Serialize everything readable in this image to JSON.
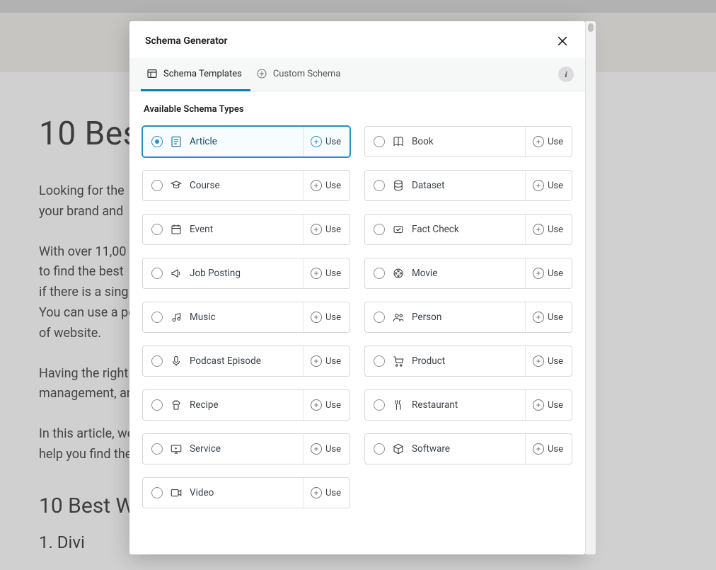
{
  "background": {
    "title": "10 Best",
    "p1": "Looking for the",
    "p1b": "your brand and",
    "p2": "With over 11,00",
    "p2b": "to find the best",
    "p2c": "if there is a sing",
    "p2d": "You can use a po",
    "p2e": "of website.",
    "p3": "Having the right",
    "p3b": "management, an",
    "p4": "In this article, we",
    "p4b": "help you find the",
    "h2": "10 Best W",
    "h3": "1. Divi"
  },
  "modal": {
    "title": "Schema Generator",
    "tab_templates": "Schema Templates",
    "tab_custom": "Custom Schema",
    "section_label": "Available Schema Types",
    "use_label": "Use",
    "types_left": [
      {
        "id": "article",
        "label": "Article",
        "icon": "article",
        "selected": true
      },
      {
        "id": "course",
        "label": "Course",
        "icon": "course"
      },
      {
        "id": "event",
        "label": "Event",
        "icon": "event"
      },
      {
        "id": "jobposting",
        "label": "Job Posting",
        "icon": "megaphone"
      },
      {
        "id": "music",
        "label": "Music",
        "icon": "music"
      },
      {
        "id": "podcast",
        "label": "Podcast Episode",
        "icon": "mic"
      },
      {
        "id": "recipe",
        "label": "Recipe",
        "icon": "recipe"
      },
      {
        "id": "service",
        "label": "Service",
        "icon": "service"
      },
      {
        "id": "video",
        "label": "Video",
        "icon": "video"
      }
    ],
    "types_right": [
      {
        "id": "book",
        "label": "Book",
        "icon": "book"
      },
      {
        "id": "dataset",
        "label": "Dataset",
        "icon": "dataset"
      },
      {
        "id": "factcheck",
        "label": "Fact Check",
        "icon": "factcheck"
      },
      {
        "id": "movie",
        "label": "Movie",
        "icon": "movie"
      },
      {
        "id": "person",
        "label": "Person",
        "icon": "person"
      },
      {
        "id": "product",
        "label": "Product",
        "icon": "product"
      },
      {
        "id": "restaurant",
        "label": "Restaurant",
        "icon": "restaurant"
      },
      {
        "id": "software",
        "label": "Software",
        "icon": "software"
      }
    ]
  }
}
